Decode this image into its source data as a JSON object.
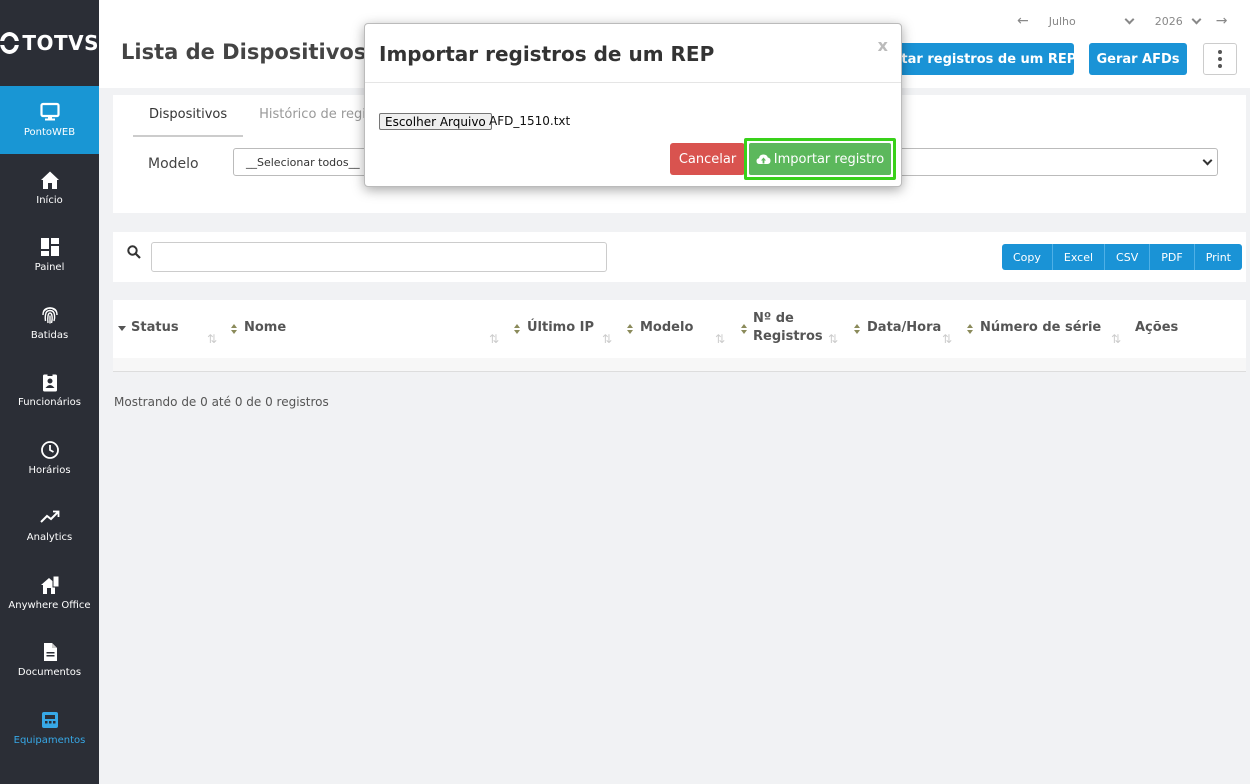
{
  "brand": {
    "logo_text": "TOTVS"
  },
  "sidebar": {
    "items": [
      {
        "label": "PontoWEB",
        "icon": "monitor-icon",
        "active": true
      },
      {
        "label": "Início",
        "icon": "home-icon"
      },
      {
        "label": "Painel",
        "icon": "dashboard-icon"
      },
      {
        "label": "Batidas",
        "icon": "fingerprint-icon"
      },
      {
        "label": "Funcionários",
        "icon": "badge-icon"
      },
      {
        "label": "Horários",
        "icon": "clock-icon"
      },
      {
        "label": "Analytics",
        "icon": "trend-icon"
      },
      {
        "label": "Anywhere Office",
        "icon": "house-office-icon"
      },
      {
        "label": "Documentos",
        "icon": "document-icon"
      },
      {
        "label": "Equipamentos",
        "icon": "equipment-icon",
        "accent": true
      }
    ]
  },
  "header": {
    "title": "Lista de Dispositivos",
    "period": {
      "month": "Julho",
      "year": "2026"
    },
    "import_button_label": "Importar registros de um REP",
    "import_button_visible": "rtar registros de um REP",
    "generate_button_label": "Gerar AFDs"
  },
  "tabs": [
    {
      "label": "Dispositivos",
      "active": true
    },
    {
      "label": "Histórico de regist"
    }
  ],
  "filter": {
    "label": "Modelo",
    "selected": "__Selecionar todos__"
  },
  "search": {
    "placeholder": ""
  },
  "export_buttons": [
    "Copy",
    "Excel",
    "CSV",
    "PDF",
    "Print"
  ],
  "table": {
    "columns": [
      "Status",
      "Nome",
      "Último IP",
      "Modelo",
      "Nº de",
      "Registros",
      "Data/Hora",
      "Número de série",
      "Ações"
    ]
  },
  "footer": {
    "info": "Mostrando de 0 até 0 de 0 registros"
  },
  "modal": {
    "title": "Importar registros de um REP",
    "close_label": "x",
    "file_button": "Escolher Arquivo",
    "file_name": "AFD_1510.txt",
    "cancel_label": "Cancelar",
    "import_label": "Importar registro"
  },
  "colors": {
    "sidebar_bg": "#2b2e36",
    "primary": "#1a93d6",
    "danger": "#d9534f",
    "success": "#5cb85c",
    "highlight": "#39d11a"
  }
}
